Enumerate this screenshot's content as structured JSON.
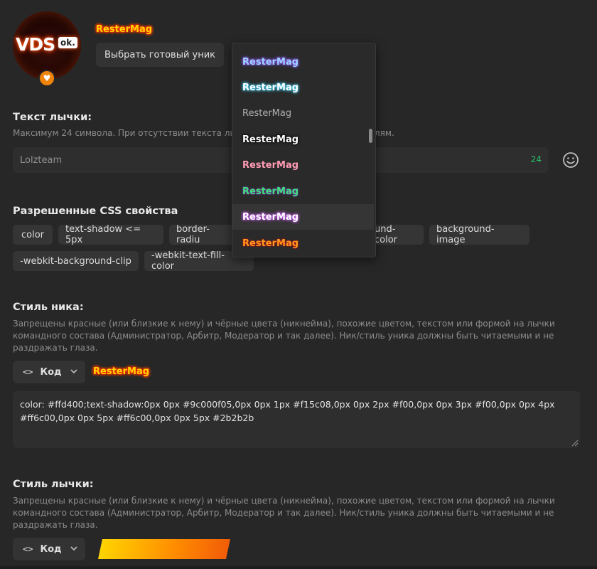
{
  "profile": {
    "avatar_text": "VDS",
    "avatar_badge_text": "ok.",
    "nickname": "ResterMag",
    "choose_unique_button": "Выбрать готовый уник"
  },
  "dropdown": {
    "items": [
      {
        "label": "ResterMag"
      },
      {
        "label": "ResterMag"
      },
      {
        "label": "ResterMag"
      },
      {
        "label": "ResterMag"
      },
      {
        "label": "ResterMag"
      },
      {
        "label": "ResterMag"
      },
      {
        "label": "ResterMag"
      },
      {
        "label": "ResterMag"
      }
    ]
  },
  "tag_text": {
    "title": "Текст лычки:",
    "hint_visible_left": "Максимум 24 символа. При отсутствии текста лы",
    "hint_visible_right": "лям.",
    "input_value": "Lolzteam",
    "counter": "24"
  },
  "css_props": {
    "title": "Разрешенные CSS свойства",
    "chips": [
      "color",
      "text-shadow <= 5px",
      "border-radiu",
      "und-color",
      "background-image",
      "-webkit-background-clip",
      "-webkit-text-fill-color"
    ]
  },
  "nick_style": {
    "title": "Стиль ника:",
    "hint": "Запрещены красные (или близкие к нему) и чёрные цвета (никнейма), похожие цветом, текстом или формой на лычки командного состава (Администратор, Арбитр, Модератор и так далее). Ник/стиль уника должны быть читаемыми и не раздражать глаза.",
    "code_button": "Код",
    "preview": "ResterMag",
    "css_line1": "color: #ffd400;text-shadow:0px 0px #9c000f05,0px 0px 1px #f15c08,0px 0px 2px #f00,0px 0px 3px #f00,0px 0px 4px",
    "css_line2": "#ff6c00,0px 0px 5px #ff6c00,0px 0px 5px #2b2b2b"
  },
  "tag_style": {
    "title": "Стиль лычки:",
    "hint": "Запрещены красные (или близкие к нему) и чёрные цвета (никнейма), похожие цветом, текстом или формой на лычки командного состава (Администратор, Арбитр, Модератор и так далее). Ник/стиль уника должны быть читаемыми и не раздражать глаза.",
    "code_button": "Код"
  },
  "colors": {
    "background": "#272727",
    "accent_orange": "#f0840a",
    "counter_green": "#27c06a",
    "nick_yellow": "#ffd400"
  }
}
